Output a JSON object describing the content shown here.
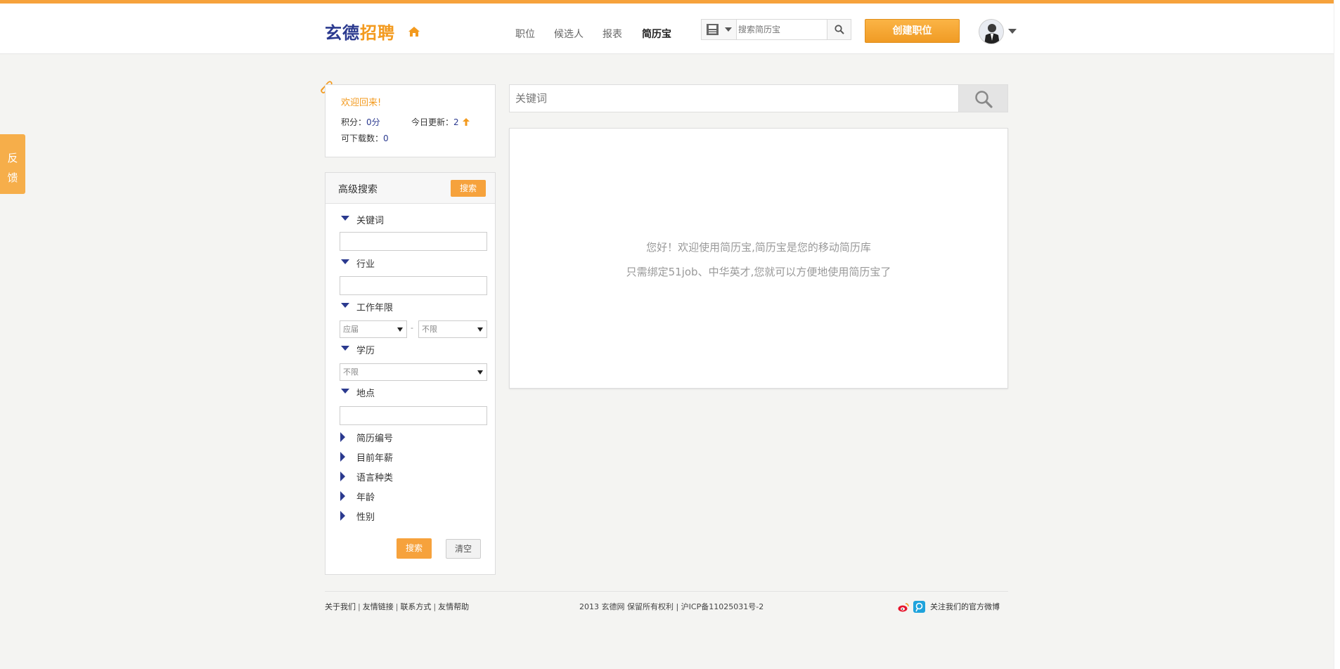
{
  "header": {
    "logo_part1": "玄德",
    "logo_part2": "招聘",
    "nav": [
      "职位",
      "候选人",
      "报表",
      "简历宝"
    ],
    "active_nav": "简历宝",
    "search_placeholder": "搜索简历宝",
    "create_button": "创建职位"
  },
  "feedback": {
    "char1": "反",
    "char2": "馈"
  },
  "welcome": {
    "title": "欢迎回来!",
    "points_label": "积分：",
    "points_value": "0分",
    "today_label": "今日更新：",
    "today_value": "2",
    "downloads_label": "可下载数：",
    "downloads_value": "0"
  },
  "advanced_search": {
    "title": "高级搜索",
    "search_button": "搜索",
    "fields": {
      "keyword": "关键词",
      "industry": "行业",
      "work_years": "工作年限",
      "education": "学历",
      "location": "地点"
    },
    "work_years_from": "应届",
    "work_years_to": "不限",
    "education_value": "不限",
    "collapsed": [
      "简历编号",
      "目前年薪",
      "语言种类",
      "年龄",
      "性别"
    ],
    "submit_button": "搜索",
    "clear_button": "清空"
  },
  "main": {
    "search_placeholder": "关键词",
    "message_line1": "您好！欢迎使用简历宝,简历宝是您的移动简历库",
    "message_line2": "只需绑定51job、中华英才,您就可以方便地使用简历宝了"
  },
  "footer": {
    "links": [
      "关于我们",
      "友情链接",
      "联系方式",
      "友情帮助"
    ],
    "copyright": "2013 玄德网 保留所有权利 | 沪ICP备11025031号-2",
    "follow": "关注我们的官方微博"
  },
  "colors": {
    "accent": "#f6a23c",
    "brand_blue": "#2b3a8f"
  }
}
